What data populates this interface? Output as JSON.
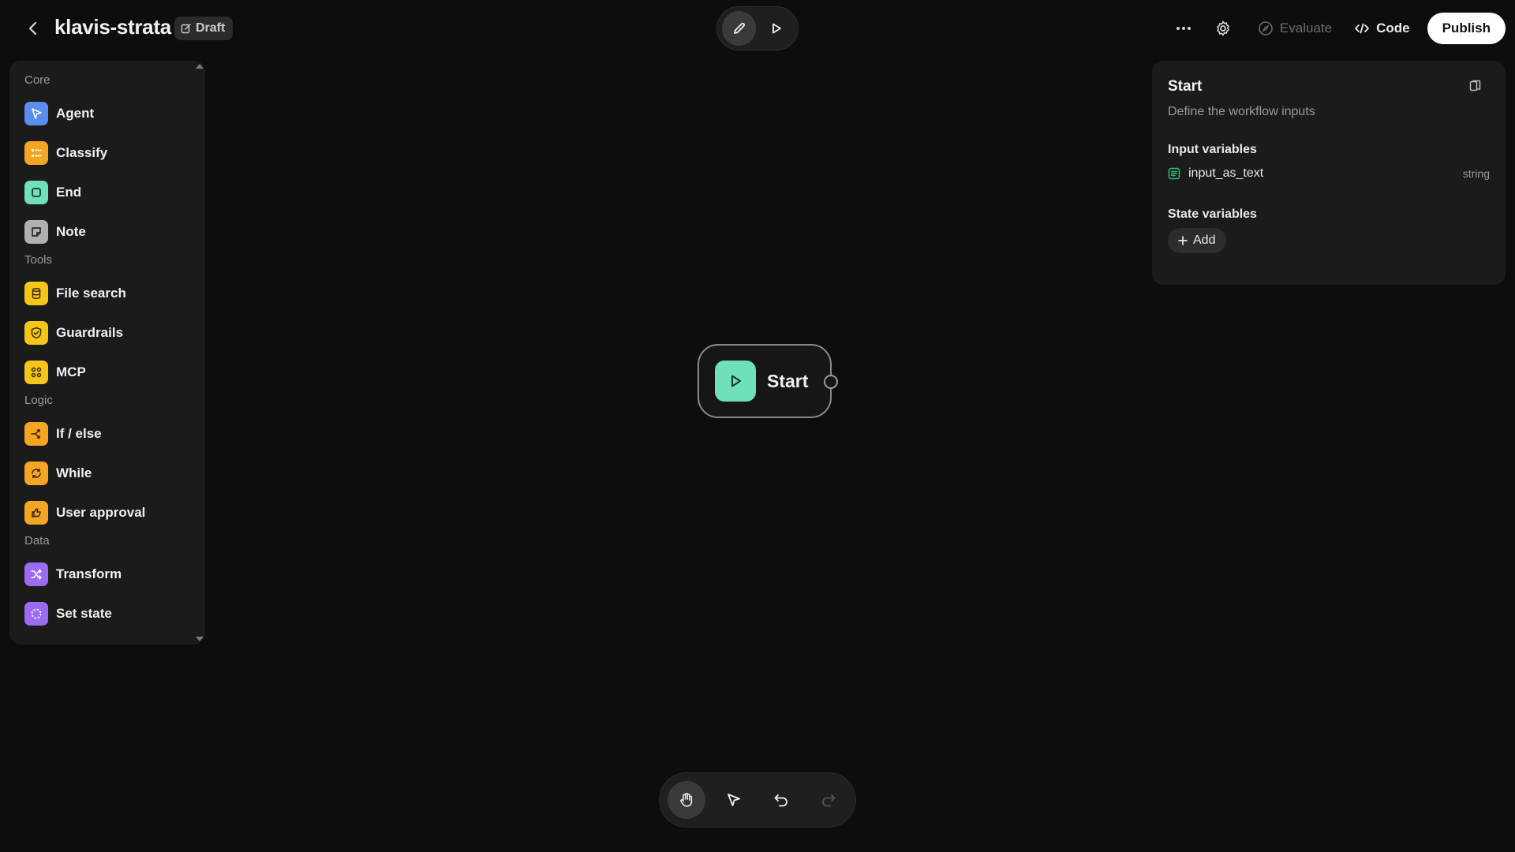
{
  "header": {
    "title": "klavis-strata",
    "badge": "Draft",
    "actions": {
      "evaluate_label": "Evaluate",
      "code_label": "Code",
      "publish_label": "Publish"
    }
  },
  "sidebar": {
    "sections": [
      {
        "label": "Core",
        "items": [
          {
            "label": "Agent",
            "icon": "agent-icon",
            "color": "#5b8def"
          },
          {
            "label": "Classify",
            "icon": "classify-icon",
            "color": "#f5a524"
          },
          {
            "label": "End",
            "icon": "end-icon",
            "color": "#6fe0b8"
          },
          {
            "label": "Note",
            "icon": "note-icon",
            "color": "#b0b0b0"
          }
        ]
      },
      {
        "label": "Tools",
        "items": [
          {
            "label": "File search",
            "icon": "database-icon",
            "color": "#f5c518"
          },
          {
            "label": "Guardrails",
            "icon": "shield-icon",
            "color": "#f5c518"
          },
          {
            "label": "MCP",
            "icon": "mcp-icon",
            "color": "#f5c518"
          }
        ]
      },
      {
        "label": "Logic",
        "items": [
          {
            "label": "If / else",
            "icon": "branch-icon",
            "color": "#f5a524"
          },
          {
            "label": "While",
            "icon": "loop-icon",
            "color": "#f5a524"
          },
          {
            "label": "User approval",
            "icon": "approval-icon",
            "color": "#f5a524"
          }
        ]
      },
      {
        "label": "Data",
        "items": [
          {
            "label": "Transform",
            "icon": "shuffle-icon",
            "color": "#9b6cf0"
          },
          {
            "label": "Set state",
            "icon": "state-icon",
            "color": "#9b6cf0"
          }
        ]
      }
    ]
  },
  "canvas": {
    "start_node": {
      "label": "Start"
    }
  },
  "inspector": {
    "title": "Start",
    "subtitle": "Define the workflow inputs",
    "input_section": "Input variables",
    "input_var": {
      "name": "input_as_text",
      "type": "string"
    },
    "state_section": "State variables",
    "add_label": "Add"
  }
}
